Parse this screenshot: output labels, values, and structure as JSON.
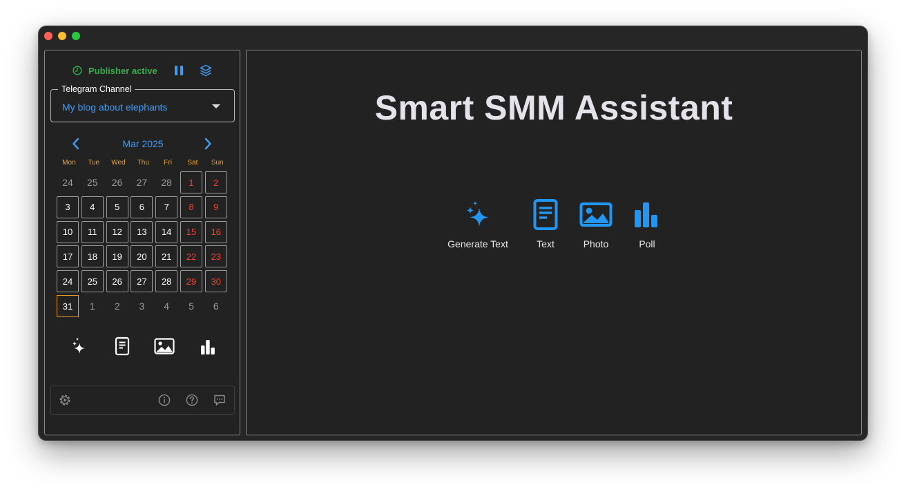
{
  "publisher": {
    "status_text": "Publisher active"
  },
  "channel": {
    "label": "Telegram Channel",
    "value": "My blog about elephants"
  },
  "calendar": {
    "month_label": "Mar 2025",
    "weekdays": [
      "Mon",
      "Tue",
      "Wed",
      "Thu",
      "Fri",
      "Sat",
      "Sun"
    ],
    "weeks": [
      [
        "24",
        "25",
        "26",
        "27",
        "28",
        "1",
        "2"
      ],
      [
        "3",
        "4",
        "5",
        "6",
        "7",
        "8",
        "9"
      ],
      [
        "10",
        "11",
        "12",
        "13",
        "14",
        "15",
        "16"
      ],
      [
        "17",
        "18",
        "19",
        "20",
        "21",
        "22",
        "23"
      ],
      [
        "24",
        "25",
        "26",
        "27",
        "28",
        "29",
        "30"
      ],
      [
        "31",
        "1",
        "2",
        "3",
        "4",
        "5",
        "6"
      ]
    ],
    "today": "31"
  },
  "main": {
    "title": "Smart SMM Assistant",
    "actions": [
      {
        "label": "Generate Text",
        "icon": "sparkles-icon"
      },
      {
        "label": "Text",
        "icon": "document-icon"
      },
      {
        "label": "Photo",
        "icon": "photo-icon"
      },
      {
        "label": "Poll",
        "icon": "bar-chart-icon"
      }
    ]
  },
  "colors": {
    "accent": "#3d9cf5",
    "active_green": "#34b04a",
    "weekend_red": "#f04038",
    "weekday_header": "#f0a030",
    "today_border": "#e89a2a"
  }
}
